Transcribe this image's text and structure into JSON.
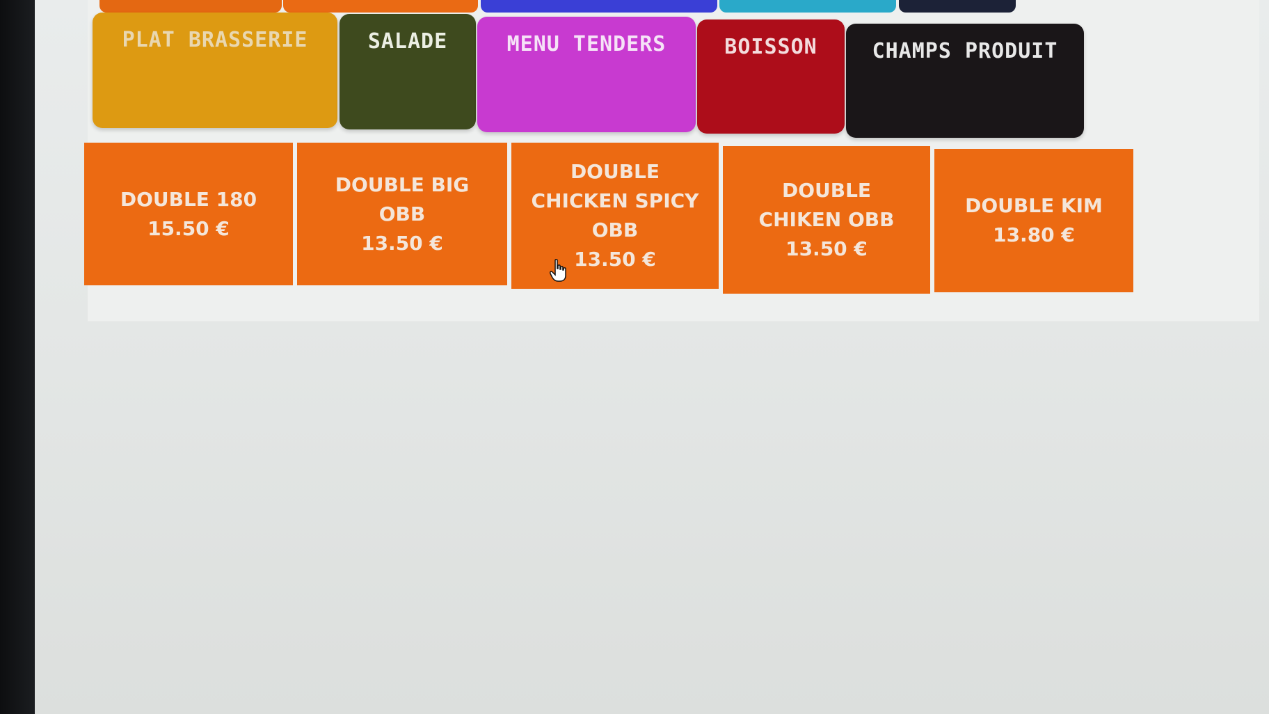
{
  "colors": {
    "product_tile": "#ec6a12",
    "product_text": "#f4e6da"
  },
  "top_tabs_partial": [
    {
      "color": "#e46812"
    },
    {
      "color": "#ea6a14"
    },
    {
      "color": "#3a3fd6"
    },
    {
      "color": "#2aa9c9"
    },
    {
      "color": "#1c2237"
    }
  ],
  "categories": [
    {
      "label": "PLAT BRASSERIE",
      "color": "#dd9a12",
      "text_color": "#e9d7b0"
    },
    {
      "label": "SALADE",
      "color": "#3e4a1e",
      "text_color": "#ecefe4"
    },
    {
      "label": "MENU TENDERS",
      "color": "#c83ad0",
      "text_color": "#f6e2f7"
    },
    {
      "label": "BOISSON",
      "color": "#ad0d1a",
      "text_color": "#f3dcdd"
    },
    {
      "label": "CHAMPS PRODUIT",
      "color": "#1a1618",
      "text_color": "#e8e8e8"
    }
  ],
  "products": [
    {
      "name": "DOUBLE 180",
      "price": "15.50 €"
    },
    {
      "name": "DOUBLE BIG\nOBB",
      "price": "13.50 €"
    },
    {
      "name": "DOUBLE\nCHICKEN SPICY\nOBB",
      "price": "13.50 €"
    },
    {
      "name": "DOUBLE\nCHIKEN OBB",
      "price": "13.50 €"
    },
    {
      "name": "DOUBLE KIM",
      "price": "13.80 €"
    }
  ],
  "cursor": {
    "icon": "hand-pointer-icon"
  }
}
